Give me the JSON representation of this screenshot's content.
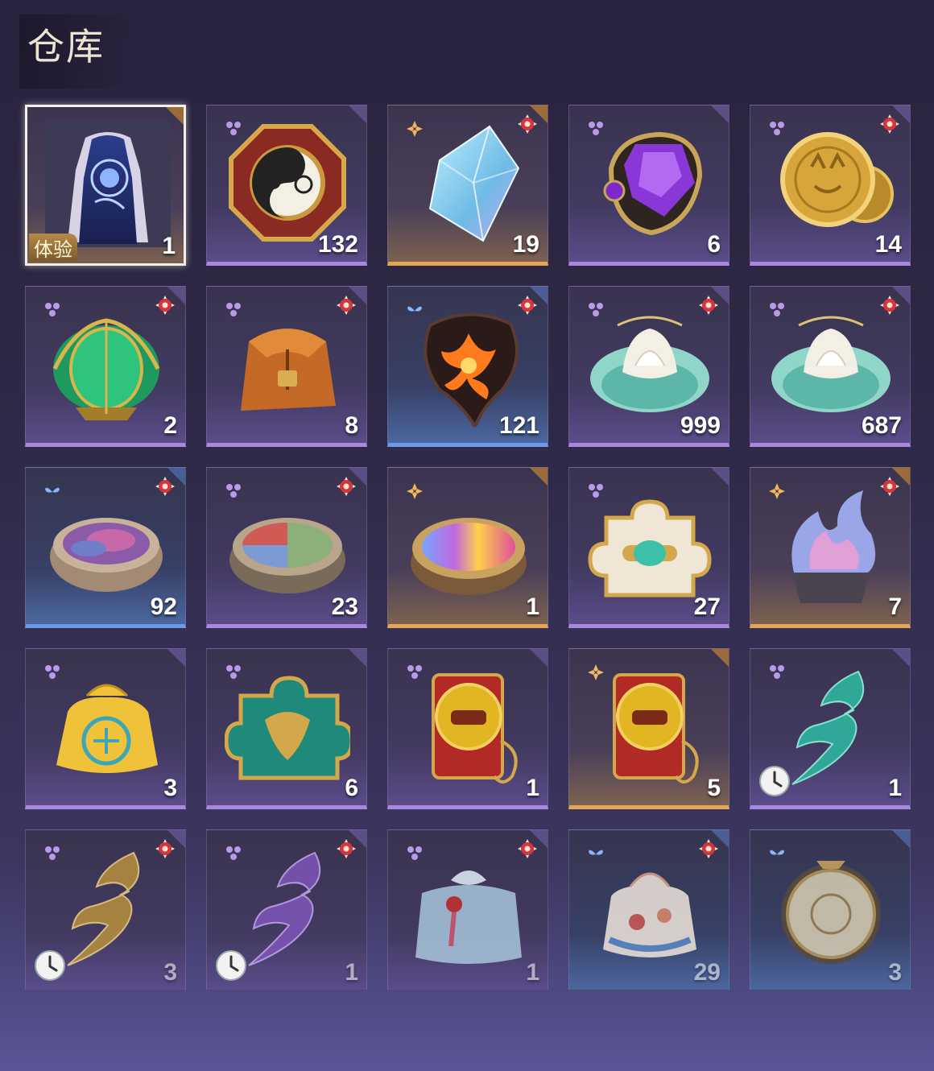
{
  "page": {
    "title": "仓库"
  },
  "items": [
    {
      "qty": "1",
      "rarity": "gold",
      "icon": "qipao-dress",
      "tag": "体验",
      "selected": true
    },
    {
      "qty": "132",
      "rarity": "purple",
      "icon": "octagon-box",
      "badge": false
    },
    {
      "qty": "19",
      "rarity": "gold",
      "icon": "blue-crystal",
      "badge": true
    },
    {
      "qty": "6",
      "rarity": "purple",
      "icon": "purple-gem",
      "badge": false
    },
    {
      "qty": "14",
      "rarity": "purple",
      "icon": "gold-coins",
      "badge": true
    },
    {
      "qty": "2",
      "rarity": "purple",
      "icon": "green-lotus-lantern",
      "badge": true
    },
    {
      "qty": "8",
      "rarity": "purple",
      "icon": "leather-pouch",
      "badge": true
    },
    {
      "qty": "121",
      "rarity": "blue",
      "icon": "fire-shard",
      "badge": true
    },
    {
      "qty": "999",
      "rarity": "purple",
      "icon": "jade-lotus",
      "badge": true
    },
    {
      "qty": "687",
      "rarity": "purple",
      "icon": "jade-lotus",
      "badge": true
    },
    {
      "qty": "92",
      "rarity": "blue",
      "icon": "pink-powder-bowl",
      "badge": true
    },
    {
      "qty": "23",
      "rarity": "purple",
      "icon": "tri-powder-bowl",
      "badge": true
    },
    {
      "qty": "1",
      "rarity": "gold",
      "icon": "rainbow-powder-bowl",
      "badge": false
    },
    {
      "qty": "27",
      "rarity": "purple",
      "icon": "pearl-puzzle-piece",
      "badge": false
    },
    {
      "qty": "7",
      "rarity": "gold",
      "icon": "opal-flame-stone",
      "badge": true
    },
    {
      "qty": "3",
      "rarity": "purple",
      "icon": "yellow-sachet",
      "badge": false
    },
    {
      "qty": "6",
      "rarity": "purple",
      "icon": "jade-puzzle-piece",
      "badge": false
    },
    {
      "qty": "1",
      "rarity": "purple",
      "icon": "red-scroll-token",
      "badge": false
    },
    {
      "qty": "5",
      "rarity": "gold",
      "icon": "red-scroll-token",
      "badge": false
    },
    {
      "qty": "1",
      "rarity": "purple",
      "icon": "teal-swirl",
      "badge": false,
      "timed": true
    },
    {
      "qty": "3",
      "rarity": "purple",
      "icon": "gold-swirl",
      "badge": true,
      "timed": true,
      "faded": true
    },
    {
      "qty": "1",
      "rarity": "purple",
      "icon": "violet-swirl",
      "badge": true,
      "timed": true,
      "faded": true
    },
    {
      "qty": "1",
      "rarity": "purple",
      "icon": "cloth-gift-bundle",
      "badge": true,
      "faded": true
    },
    {
      "qty": "29",
      "rarity": "blue",
      "icon": "floral-pouch",
      "badge": true,
      "faded": true
    },
    {
      "qty": "3",
      "rarity": "blue",
      "icon": "round-drum-charm",
      "badge": false,
      "faded": true
    }
  ],
  "colors": {
    "gold": "#e3a654",
    "purple": "#a889de",
    "blue": "#6c9ae6",
    "badge_red": "#d8343c"
  }
}
